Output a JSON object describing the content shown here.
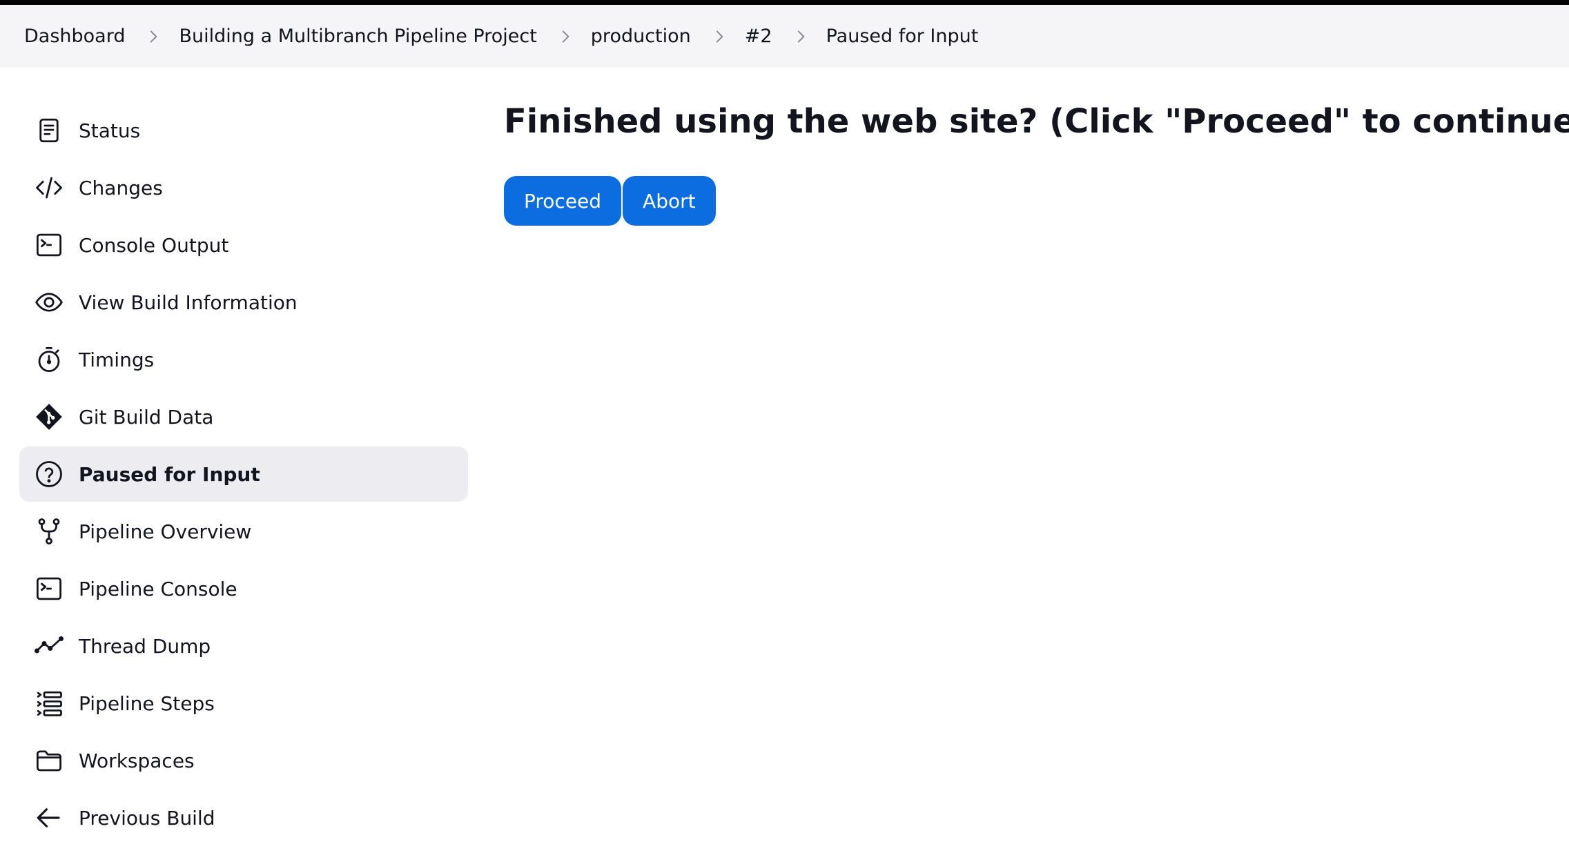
{
  "breadcrumb": [
    {
      "label": "Dashboard"
    },
    {
      "label": "Building a Multibranch Pipeline Project"
    },
    {
      "label": "production"
    },
    {
      "label": "#2"
    },
    {
      "label": "Paused for Input"
    }
  ],
  "sidebar": {
    "items": [
      {
        "label": "Status",
        "icon": "document-icon"
      },
      {
        "label": "Changes",
        "icon": "code-icon"
      },
      {
        "label": "Console Output",
        "icon": "terminal-icon"
      },
      {
        "label": "View Build Information",
        "icon": "eye-icon"
      },
      {
        "label": "Timings",
        "icon": "stopwatch-icon"
      },
      {
        "label": "Git Build Data",
        "icon": "git-icon"
      },
      {
        "label": "Paused for Input",
        "icon": "question-icon",
        "active": true
      },
      {
        "label": "Pipeline Overview",
        "icon": "branch-icon"
      },
      {
        "label": "Pipeline Console",
        "icon": "terminal-icon"
      },
      {
        "label": "Thread Dump",
        "icon": "trend-icon"
      },
      {
        "label": "Pipeline Steps",
        "icon": "list-icon"
      },
      {
        "label": "Workspaces",
        "icon": "folder-icon"
      },
      {
        "label": "Previous Build",
        "icon": "arrow-left-icon"
      }
    ]
  },
  "main": {
    "title": "Finished using the web site? (Click \"Proceed\" to continue)",
    "proceed_label": "Proceed",
    "abort_label": "Abort"
  },
  "colors": {
    "accent": "#0b6ddf",
    "breadcrumb_bg": "#f5f5f7",
    "active_item_bg": "#ededf1"
  }
}
